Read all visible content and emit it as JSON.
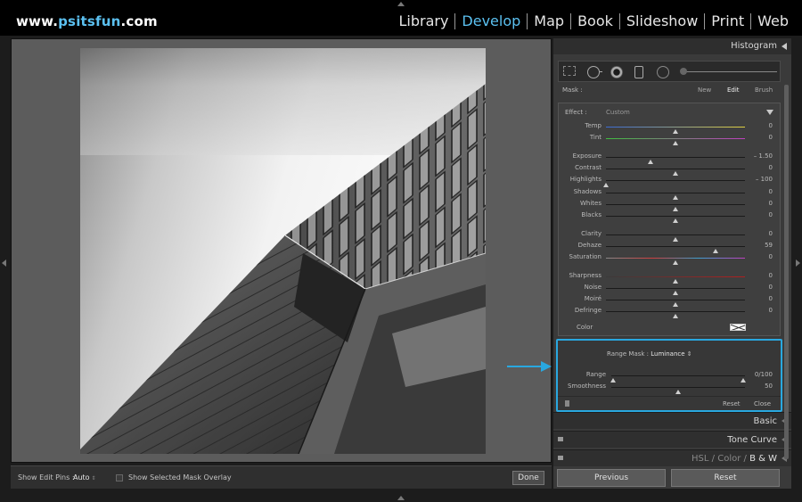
{
  "branding": {
    "logo_prefix": "www.",
    "logo_accent": "psitsfun",
    "logo_suffix": ".com",
    "accent_color": "#5bc0f0"
  },
  "modules": [
    {
      "label": "Library",
      "active": false
    },
    {
      "label": "Develop",
      "active": true
    },
    {
      "label": "Map",
      "active": false
    },
    {
      "label": "Book",
      "active": false
    },
    {
      "label": "Slideshow",
      "active": false
    },
    {
      "label": "Print",
      "active": false
    },
    {
      "label": "Web",
      "active": false
    }
  ],
  "toolbar": {
    "pins_label": "Show Edit Pins :",
    "pins_value": "Auto",
    "overlay_label": "Show Selected Mask Overlay",
    "done_label": "Done"
  },
  "panel": {
    "histogram_label": "Histogram",
    "mask_label": "Mask :",
    "mask_new": "New",
    "mask_edit": "Edit",
    "mask_brush": "Brush",
    "effect_label": "Effect :",
    "effect_value": "Custom",
    "color_label": "Color",
    "sliders": [
      {
        "label": "Temp",
        "value": "0",
        "pos": 0.5,
        "track": "temp"
      },
      {
        "label": "Tint",
        "value": "0",
        "pos": 0.5,
        "track": "tint"
      },
      {
        "label": "Exposure",
        "value": "– 1.50",
        "pos": 0.32,
        "track": "plain"
      },
      {
        "label": "Contrast",
        "value": "0",
        "pos": 0.5,
        "track": "plain"
      },
      {
        "label": "Highlights",
        "value": "– 100",
        "pos": 0.0,
        "track": "plain"
      },
      {
        "label": "Shadows",
        "value": "0",
        "pos": 0.5,
        "track": "plain"
      },
      {
        "label": "Whites",
        "value": "0",
        "pos": 0.5,
        "track": "plain"
      },
      {
        "label": "Blacks",
        "value": "0",
        "pos": 0.5,
        "track": "plain"
      },
      {
        "label": "Clarity",
        "value": "0",
        "pos": 0.5,
        "track": "plain"
      },
      {
        "label": "Dehaze",
        "value": "59",
        "pos": 0.79,
        "track": "plain"
      },
      {
        "label": "Saturation",
        "value": "0",
        "pos": 0.5,
        "track": "sat"
      },
      {
        "label": "Sharpness",
        "value": "0",
        "pos": 0.5,
        "track": "sharp"
      },
      {
        "label": "Noise",
        "value": "0",
        "pos": 0.5,
        "track": "plain"
      },
      {
        "label": "Moiré",
        "value": "0",
        "pos": 0.5,
        "track": "plain"
      },
      {
        "label": "Defringe",
        "value": "0",
        "pos": 0.5,
        "track": "plain"
      }
    ],
    "range_mask": {
      "title_prefix": "Range Mask :",
      "title_value": "Luminance",
      "range_label": "Range",
      "range_value": "0/100",
      "smoothness_label": "Smoothness",
      "smoothness_value": "50",
      "smoothness_pos": 0.5,
      "reset_label": "Reset",
      "close_label": "Close",
      "highlight_color": "#29a8e0"
    },
    "basic_label": "Basic",
    "tone_curve_label": "Tone Curve",
    "hsl_label": "HSL",
    "color_tab": "Color",
    "bw_label": "B & W",
    "slash": "/",
    "prev_label": "Previous",
    "reset_label": "Reset"
  }
}
